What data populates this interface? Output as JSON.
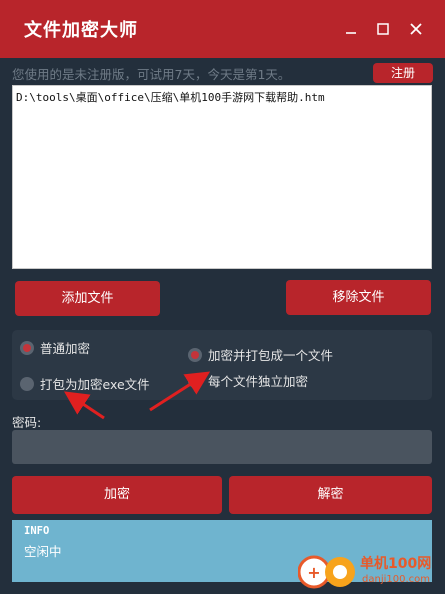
{
  "window": {
    "title": "文件加密大师",
    "minimize_icon": "minimize-icon",
    "maximize_icon": "maximize-icon",
    "close_icon": "close-icon"
  },
  "notice": {
    "text": "您使用的是未注册版，可试用7天，今天是第1天。",
    "register_label": "注册"
  },
  "file_list": {
    "items": [
      "D:\\tools\\桌面\\office\\压缩\\单机100手游网下载帮助.htm"
    ]
  },
  "buttons": {
    "add_file": "添加文件",
    "remove_file": "移除文件",
    "encrypt": "加密",
    "decrypt": "解密"
  },
  "options": {
    "normal_encrypt": "普通加密",
    "pack_exe": "打包为加密exe文件",
    "pack_single": "加密并打包成一个文件",
    "each_independent": "每个文件独立加密"
  },
  "password": {
    "label": "密码:",
    "value": ""
  },
  "info": {
    "title": "INFO",
    "status": "空闲中"
  },
  "watermark": {
    "line1": "单机100网",
    "line2": "danji100.com"
  },
  "colors": {
    "accent": "#b8252b",
    "background": "#232f3c",
    "info_bg": "#6fb4cf"
  }
}
